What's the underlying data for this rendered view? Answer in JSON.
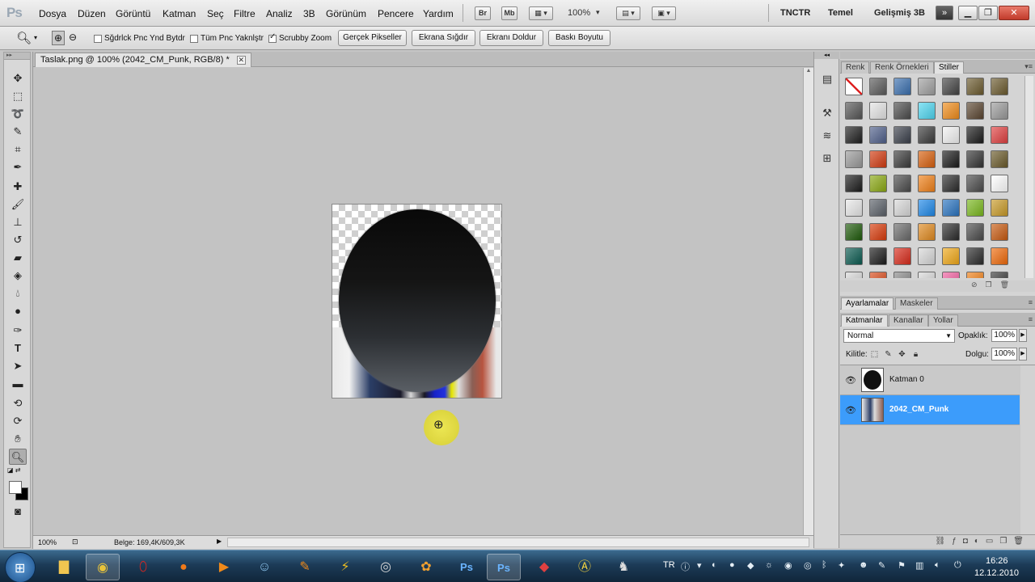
{
  "app": {
    "logo": "Ps"
  },
  "menubar": {
    "items": [
      "Dosya",
      "Düzen",
      "Görüntü",
      "Katman",
      "Seç",
      "Filtre",
      "Analiz",
      "3B",
      "Görünüm",
      "Pencere",
      "Yardım"
    ],
    "bridge_label": "Br",
    "minibridge_label": "Mb",
    "zoom": "100%",
    "workspaces": [
      "TNCTR",
      "Temel",
      "Gelişmiş 3B"
    ],
    "more": "»"
  },
  "options": {
    "check_resize": "Sğdrlck Pnc Ynd Bytdr",
    "check_all_windows": "Tüm Pnc Yaknlştr",
    "check_scrubby": "Scrubby Zoom",
    "btn_actual": "Gerçek Pikseller",
    "btn_fit": "Ekrana Sığdır",
    "btn_fill": "Ekranı Doldur",
    "btn_print": "Baskı Boyutu"
  },
  "document": {
    "tab_title": "Taslak.png @ 100% (2042_CM_Punk, RGB/8) *",
    "zoom_status": "100%",
    "doc_info": "Belge: 169,4K/609,3K"
  },
  "panels": {
    "style_tabs": [
      "Renk",
      "Renk Örnekleri",
      "Stiller"
    ],
    "adj_tabs": [
      "Ayarlamalar",
      "Maskeler"
    ],
    "layer_tabs": [
      "Katmanlar",
      "Kanallar",
      "Yollar"
    ],
    "blend_mode": "Normal",
    "opacity_label": "Opaklık:",
    "opacity_value": "100%",
    "lock_label": "Kilitle:",
    "fill_label": "Dolgu:",
    "fill_value": "100%",
    "layers": [
      {
        "name": "Katman 0",
        "selected": false
      },
      {
        "name": "2042_CM_Punk",
        "selected": true
      }
    ],
    "style_colors": [
      "#ffffff",
      "#5a5a5a",
      "#3a6fae",
      "#a0a0a0",
      "#444444",
      "#6b5a2e",
      "#6b5a2e",
      "#555555",
      "#e4e4e4",
      "#4b4b4b",
      "#4fd6f0",
      "#f08c1a",
      "#5a4530",
      "#9a9a9a",
      "#1e1e1e",
      "#4f5f8a",
      "#3a3f4a",
      "#3a3a3a",
      "#f2f2f2",
      "#1a1a1a",
      "#e04040",
      "#9a9a9a",
      "#d23a10",
      "#3a3a3a",
      "#d8600e",
      "#1a1a1a",
      "#333333",
      "#6a5a2a",
      "#1a1a1a",
      "#8aa812",
      "#4a4a4a",
      "#f08018",
      "#2a2a2a",
      "#4a4a4a",
      "#ffffff",
      "#e8e8e8",
      "#5a6068",
      "#d8d8d8",
      "#1e88e8",
      "#2a74c0",
      "#7ab81e",
      "#c89a28",
      "#1e5a0a",
      "#d83a0a",
      "#6a6a6a",
      "#e08a20",
      "#2a2a2a",
      "#4a4a4a",
      "#c85a10",
      "#0a5a50",
      "#1a1a1a",
      "#d82a1a",
      "#d8d8d8",
      "#f0a818",
      "#2a2a2a",
      "#f06a0a",
      "#d8d8d8",
      "#d84a1a",
      "#8a8a8a",
      "#d8d8d8",
      "#f060a0",
      "#f08018",
      "#3a3a3a"
    ]
  },
  "taskbar": {
    "lang": "TR",
    "time": "16:26",
    "date": "12.12.2010"
  }
}
